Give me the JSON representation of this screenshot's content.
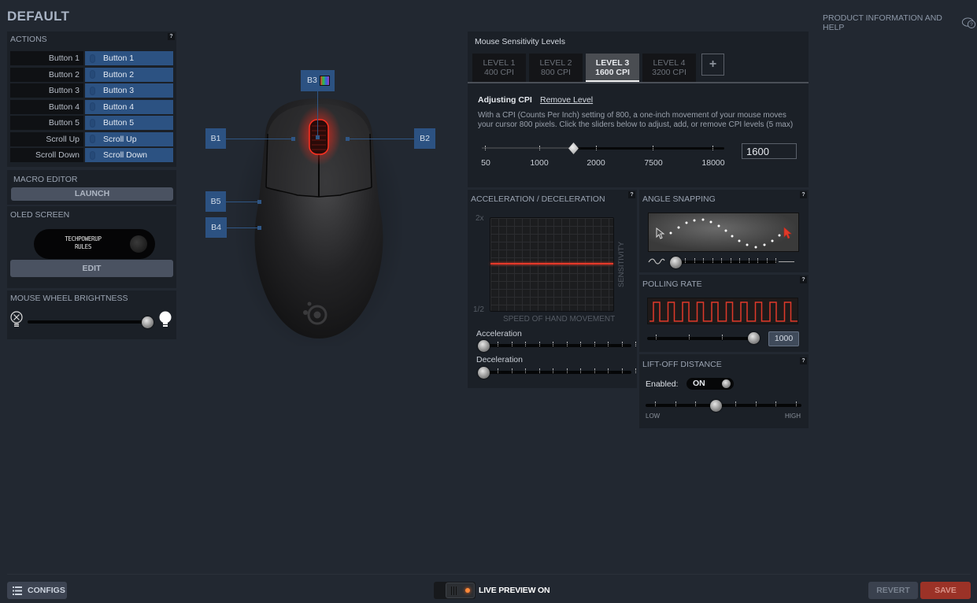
{
  "header": {
    "title": "DEFAULT",
    "help_link": "PRODUCT INFORMATION AND HELP",
    "help_icon": "chat-help-icon"
  },
  "actions": {
    "title": "ACTIONS",
    "help": "?",
    "rows": [
      {
        "button": "Button 1",
        "action": "Button 1"
      },
      {
        "button": "Button 2",
        "action": "Button 2"
      },
      {
        "button": "Button 3",
        "action": "Button 3"
      },
      {
        "button": "Button 4",
        "action": "Button 4"
      },
      {
        "button": "Button 5",
        "action": "Button 5"
      },
      {
        "button": "Scroll Up",
        "action": "Scroll Up"
      },
      {
        "button": "Scroll Down",
        "action": "Scroll Down"
      }
    ]
  },
  "macro_editor": {
    "title": "MACRO EDITOR",
    "launch_label": "LAUNCH"
  },
  "oled": {
    "title": "OLED SCREEN",
    "line1": "TECHPOWERUP",
    "line2": "RULES",
    "edit_label": "EDIT"
  },
  "wheel_brightness": {
    "title": "MOUSE WHEEL BRIGHTNESS",
    "value_fraction": 0.95
  },
  "mouse_buttons": {
    "b1": "B1",
    "b2": "B2",
    "b3": "B3",
    "b4": "B4",
    "b5": "B5"
  },
  "sensitivity": {
    "title": "Mouse Sensitivity Levels",
    "levels": [
      {
        "name": "LEVEL 1",
        "cpi": "400 CPI"
      },
      {
        "name": "LEVEL 2",
        "cpi": "800 CPI"
      },
      {
        "name": "LEVEL 3",
        "cpi": "1600 CPI"
      },
      {
        "name": "LEVEL 4",
        "cpi": "3200 CPI"
      }
    ],
    "active_level": 2,
    "add_label": "+",
    "adjusting_label": "Adjusting CPI",
    "remove_label": "Remove Level",
    "description": "With a CPI (Counts Per Inch) setting of 800, a one-inch movement of your mouse moves your cursor 800 pixels. Click the sliders below to adjust, add, or remove CPI levels (5 max)",
    "ticks": [
      "50",
      "1000",
      "2000",
      "7500",
      "18000"
    ],
    "value": "1600"
  },
  "acceleration": {
    "title": "ACCELERATION / DECELERATION",
    "help": "?",
    "y_max": "2x",
    "y_min": "1/2",
    "y_label": "SENSITIVITY",
    "x_label": "SPEED OF HAND MOVEMENT",
    "accel_label": "Acceleration",
    "decel_label": "Deceleration",
    "accel_value": 0,
    "decel_value": 0
  },
  "angle_snapping": {
    "title": "ANGLE SNAPPING",
    "help": "?",
    "value": 0
  },
  "polling_rate": {
    "title": "POLLING RATE",
    "help": "?",
    "value": "1000"
  },
  "liftoff": {
    "title": "LIFT-OFF DISTANCE",
    "help": "?",
    "enabled_label": "Enabled:",
    "toggle_label": "ON",
    "low_label": "LOW",
    "high_label": "HIGH",
    "value_fraction": 0.45
  },
  "footer": {
    "configs_label": "CONFIGS",
    "live_preview_label": "LIVE PREVIEW ON",
    "revert_label": "REVERT",
    "save_label": "SAVE"
  },
  "colors": {
    "accent_blue": "#2c5282",
    "accent_red": "#e63a2a",
    "save_red": "#9b3227",
    "background": "#222831"
  }
}
